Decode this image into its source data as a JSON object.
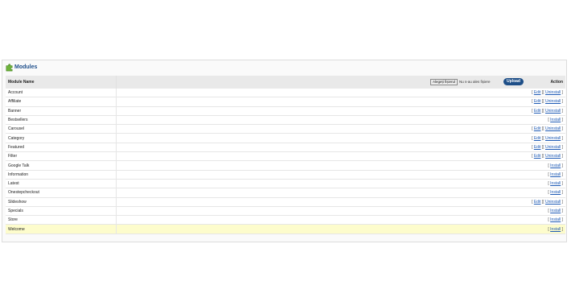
{
  "panel": {
    "title": "Modules",
    "icon": "puzzle-icon"
  },
  "table": {
    "col_name": "Module Name",
    "col_action": "Action",
    "choose_file_label": "Alegeți fișierul",
    "no_file_text": "Nu s-au ales fișiere",
    "upload_label": "Upload"
  },
  "modules": [
    {
      "name": "Account",
      "actions": [
        "Edit",
        "Uninstall"
      ]
    },
    {
      "name": "Affiliate",
      "actions": [
        "Edit",
        "Uninstall"
      ]
    },
    {
      "name": "Banner",
      "actions": [
        "Edit",
        "Uninstall"
      ]
    },
    {
      "name": "Bestsellers",
      "actions": [
        "Install"
      ]
    },
    {
      "name": "Carousel",
      "actions": [
        "Edit",
        "Uninstall"
      ]
    },
    {
      "name": "Category",
      "actions": [
        "Edit",
        "Uninstall"
      ]
    },
    {
      "name": "Featured",
      "actions": [
        "Edit",
        "Uninstall"
      ]
    },
    {
      "name": "Filter",
      "actions": [
        "Edit",
        "Uninstall"
      ]
    },
    {
      "name": "Google Talk",
      "actions": [
        "Install"
      ]
    },
    {
      "name": "Information",
      "actions": [
        "Install"
      ]
    },
    {
      "name": "Latest",
      "actions": [
        "Install"
      ]
    },
    {
      "name": "Onestepcheckout",
      "actions": [
        "Install"
      ]
    },
    {
      "name": "Slideshow",
      "actions": [
        "Edit",
        "Uninstall"
      ]
    },
    {
      "name": "Specials",
      "actions": [
        "Install"
      ]
    },
    {
      "name": "Store",
      "actions": [
        "Install"
      ]
    },
    {
      "name": "Welcome",
      "actions": [
        "Install"
      ],
      "highlighted": true
    }
  ],
  "colors": {
    "title": "#1f4f8b",
    "upload_button": "#1e4f88",
    "link": "#1f5bb5",
    "highlight_row": "#fdfccc"
  }
}
